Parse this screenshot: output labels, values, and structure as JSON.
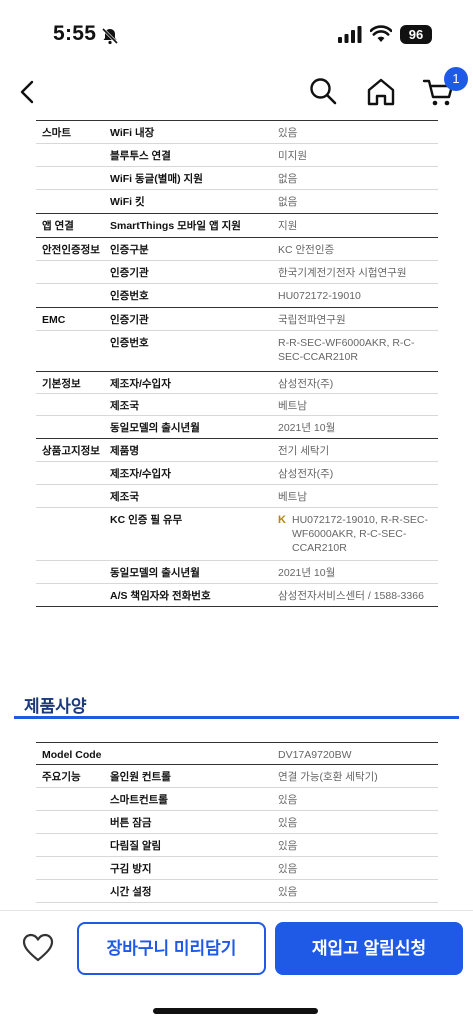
{
  "status_bar": {
    "time": "5:55",
    "battery": "96"
  },
  "header": {
    "cart_count": "1"
  },
  "spec_groups_top": [
    {
      "category": "스마트",
      "rows": [
        {
          "label": "WiFi 내장",
          "value": "있음"
        },
        {
          "label": "블루투스 연결",
          "value": "미지원"
        },
        {
          "label": "WiFi 동글(별매) 지원",
          "value": "없음"
        },
        {
          "label": "WiFi 킷",
          "value": "없음"
        }
      ]
    },
    {
      "category": "앱 연결",
      "rows": [
        {
          "label": "SmartThings 모바일 앱 지원",
          "value": "지원"
        }
      ]
    },
    {
      "category": "안전인증정보",
      "rows": [
        {
          "label": "인증구분",
          "value": "KC 안전인증"
        },
        {
          "label": "인증기관",
          "value": "한국기계전기전자 시험연구원"
        },
        {
          "label": "인증번호",
          "value": "HU072172-19010"
        }
      ]
    },
    {
      "category": "EMC",
      "rows": [
        {
          "label": "인증기관",
          "value": "국립전파연구원"
        },
        {
          "label": "인증번호",
          "value": "R-R-SEC-WF6000AKR, R-C-SEC-CCAR210R"
        }
      ]
    },
    {
      "category": "기본정보",
      "rows": [
        {
          "label": "제조자/수입자",
          "value": "삼성전자(주)"
        },
        {
          "label": "제조국",
          "value": "베트남"
        },
        {
          "label": "동일모델의 출시년월",
          "value": "2021년 10월"
        }
      ]
    },
    {
      "category": "상품고지정보",
      "rows": [
        {
          "label": "제품명",
          "value": "전기 세탁기"
        },
        {
          "label": "제조자/수입자",
          "value": "삼성전자(주)"
        },
        {
          "label": "제조국",
          "value": "베트남"
        },
        {
          "label": "KC 인증 필 유무",
          "value": "HU072172-19010, R-R-SEC-WF6000AKR, R-C-SEC-CCAR210R"
        },
        {
          "label": "동일모델의 출시년월",
          "value": "2021년 10월"
        },
        {
          "label": "A/S 책임자와 전화번호",
          "value": "삼성전자서비스센터 / 1588-3366"
        }
      ]
    }
  ],
  "section": {
    "title": "제품사양"
  },
  "spec_groups_bottom": [
    {
      "category": "Model Code",
      "rows": [
        {
          "label": "",
          "value": "DV17A9720BW"
        }
      ]
    },
    {
      "category": "주요기능",
      "rows": [
        {
          "label": "올인원 컨트롤",
          "value": "연결 가능(호환 세탁기)"
        },
        {
          "label": "스마트컨트롤",
          "value": "있음"
        },
        {
          "label": "버튼 잠금",
          "value": "있음"
        },
        {
          "label": "다림질 알림",
          "value": "있음"
        },
        {
          "label": "구김 방지",
          "value": "있음"
        },
        {
          "label": "시간 설정",
          "value": "있음"
        }
      ]
    }
  ],
  "bottom_bar": {
    "cart_button": "장바구니 미리담기",
    "notify_button": "재입고 알림신청"
  },
  "colors": {
    "accent": "#1f5ae6"
  }
}
